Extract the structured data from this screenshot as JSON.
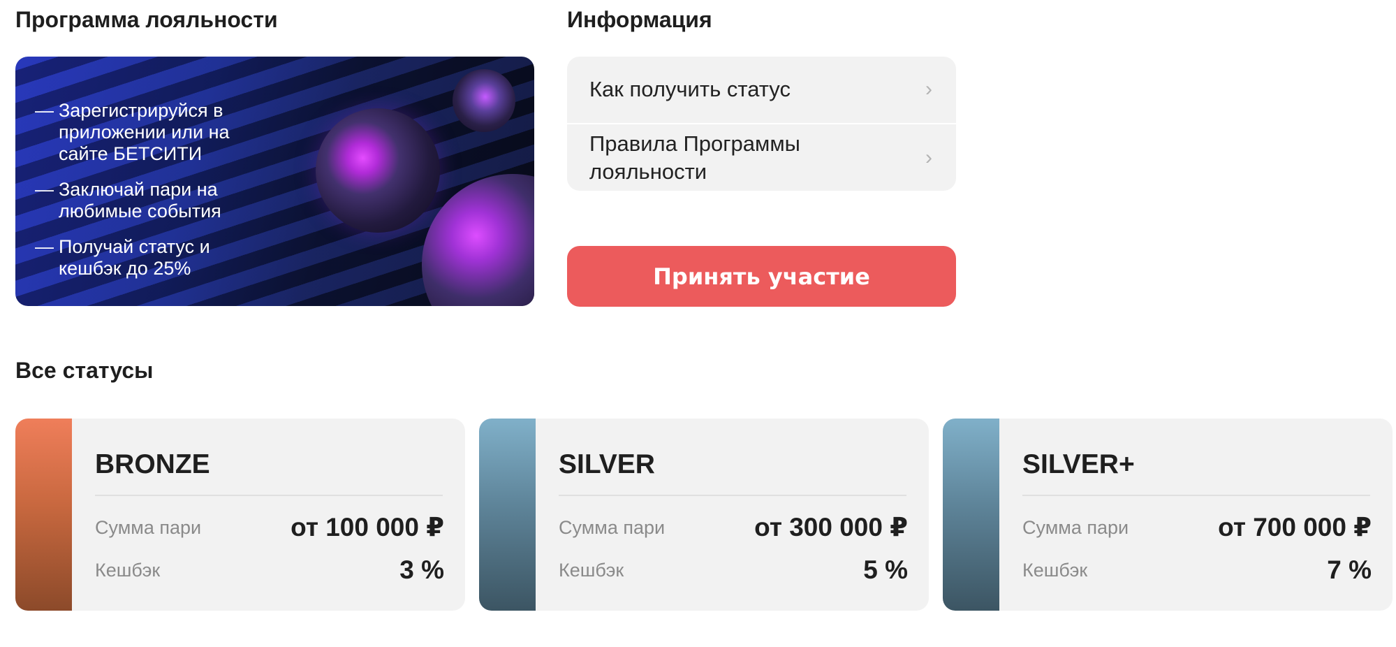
{
  "loyalty": {
    "title": "Программа лояльности",
    "bullets": [
      "Зарегистрируйся в приложении или на сайте БЕТСИТИ",
      "Заключай пари на любимые события",
      "Получай статус и кешбэк до 25%"
    ],
    "dash": "—"
  },
  "info": {
    "title": "Информация",
    "items": [
      {
        "label": "Как получить статус",
        "icon": "chevron-right-icon"
      },
      {
        "label": "Правила Программы лояльности",
        "icon": "chevron-right-icon"
      }
    ],
    "chevron": "›"
  },
  "cta": {
    "label": "Принять участие",
    "color": "#ec5b5c"
  },
  "statuses": {
    "title": "Все статусы",
    "cards": [
      {
        "name": "BRONZE",
        "bet_label": "Сумма пари",
        "bet_value": "от 100 000 ₽",
        "cashback_label": "Кешбэк",
        "cashback_value": "3 %",
        "stripe_color": "#ef7e5a"
      },
      {
        "name": "SILVER",
        "bet_label": "Сумма пари",
        "bet_value": "от 300 000 ₽",
        "cashback_label": "Кешбэк",
        "cashback_value": "5 %",
        "stripe_color": "#80b0c9"
      },
      {
        "name": "SILVER+",
        "bet_label": "Сумма пари",
        "bet_value": "от 700 000 ₽",
        "cashback_label": "Кешбэк",
        "cashback_value": "7 %",
        "stripe_color": "#80b0c9"
      }
    ]
  }
}
